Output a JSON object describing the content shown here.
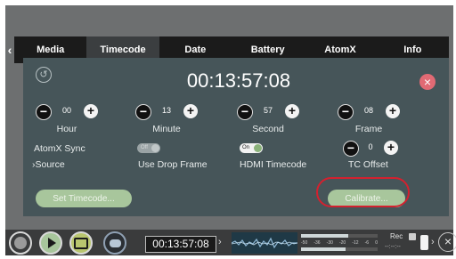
{
  "tabs": [
    {
      "label": "Media",
      "active": false
    },
    {
      "label": "Timecode",
      "active": true
    },
    {
      "label": "Date",
      "active": false
    },
    {
      "label": "Battery",
      "active": false
    },
    {
      "label": "AtomX",
      "active": false
    },
    {
      "label": "Info",
      "active": false
    }
  ],
  "nav": {
    "prev": "‹",
    "next": "›"
  },
  "panel": {
    "timecode": "00:13:57:08",
    "fields": [
      {
        "value": "00",
        "label": "Hour"
      },
      {
        "value": "13",
        "label": "Minute"
      },
      {
        "value": "57",
        "label": "Second"
      },
      {
        "value": "08",
        "label": "Frame"
      }
    ],
    "atomx_sync": {
      "label": "AtomX Sync",
      "state": "Off"
    },
    "source_label": "›Source",
    "drop_frame": {
      "label": "Use Drop Frame"
    },
    "hdmi_timecode": {
      "label": "HDMI Timecode",
      "state": "On"
    },
    "tc_offset": {
      "label": "TC Offset",
      "value": "0"
    },
    "set_timecode_label": "Set Timecode...",
    "calibrate_label": "Calibrate..."
  },
  "bottom": {
    "timecode": "00:13:57:08",
    "arrow": "›",
    "meter_scale": [
      "-50",
      "-36",
      "-30",
      "-20",
      "-12",
      "-6",
      "0"
    ],
    "rec_label": "Rec",
    "rec_sub": "--:--:--",
    "close": "×"
  },
  "colors": {
    "panel_bg": "#465559",
    "close_accent": "#e16a74",
    "button_green": "#a8c69c",
    "highlight_red": "#d3212f"
  }
}
